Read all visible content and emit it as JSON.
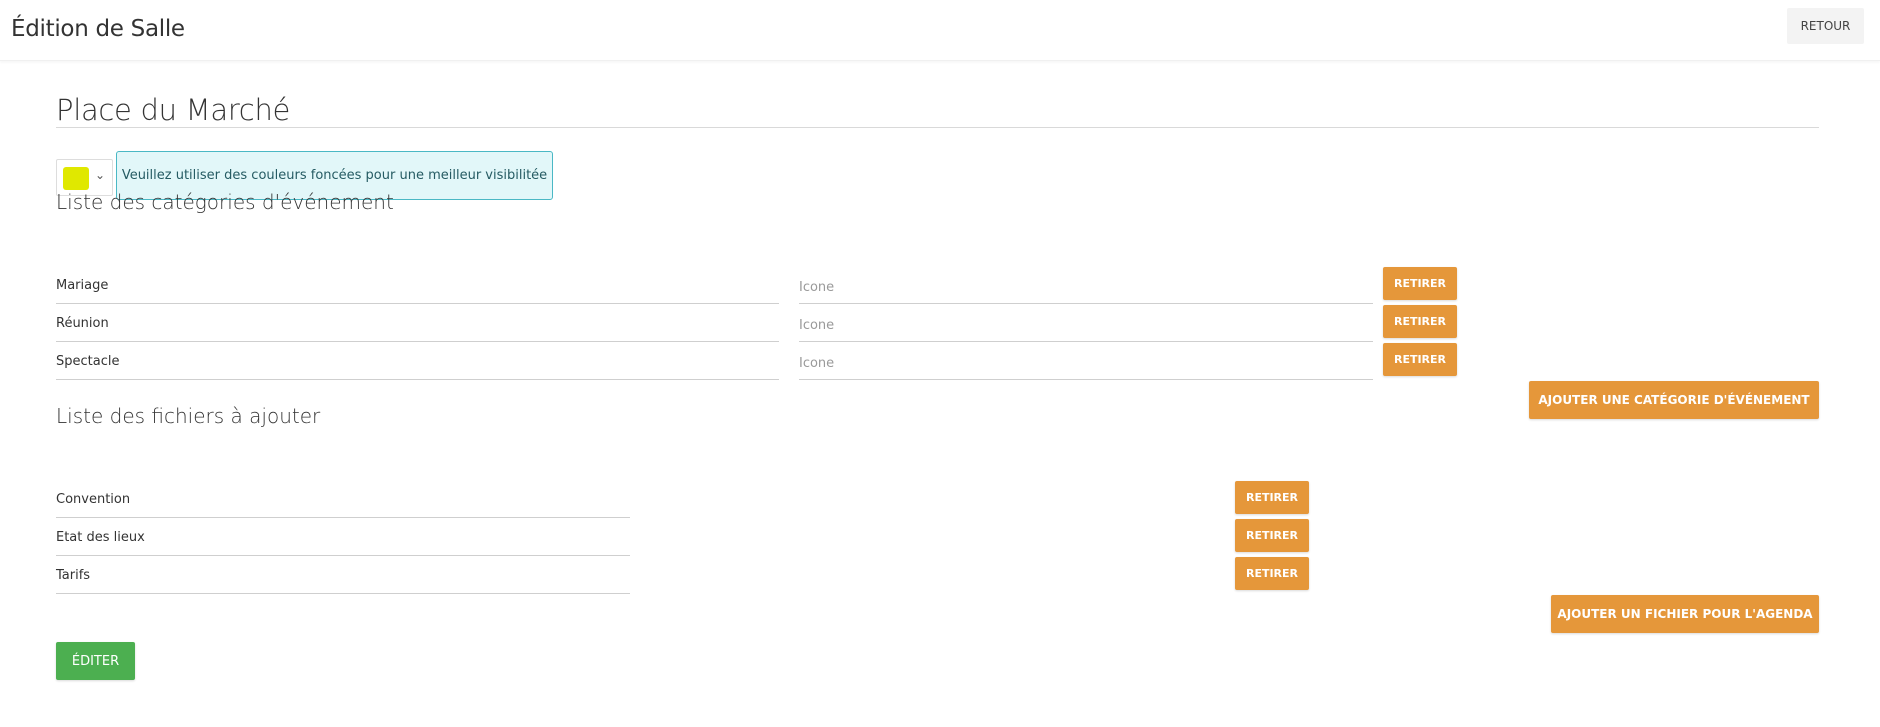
{
  "header": {
    "title": "Édition de Salle",
    "back_label": "RETOUR"
  },
  "room": {
    "name": "Place du Marché",
    "color": "#e0e800",
    "color_hint": "Veuillez utiliser des couleurs foncées pour une meilleur visibilitée"
  },
  "categories": {
    "heading": "Liste des catégories d'événement",
    "icon_placeholder": "Icone",
    "remove_label": "RETIRER",
    "add_label": "AJOUTER UNE CATÉGORIE D'ÉVÉNEMENT",
    "items": [
      {
        "name": "Mariage"
      },
      {
        "name": "Réunion"
      },
      {
        "name": "Spectacle"
      }
    ]
  },
  "files": {
    "heading": "Liste des fichiers à ajouter",
    "remove_label": "RETIRER",
    "add_label": "AJOUTER UN FICHIER POUR L'AGENDA",
    "items": [
      {
        "name": "Convention"
      },
      {
        "name": "Etat des lieux"
      },
      {
        "name": "Tarifs"
      }
    ]
  },
  "actions": {
    "edit_label": "ÉDITER"
  },
  "colors": {
    "accent_orange": "#e5973a",
    "success_green": "#4caf50",
    "info_bg": "#e2f7f9",
    "info_border": "#4ab8c5"
  }
}
